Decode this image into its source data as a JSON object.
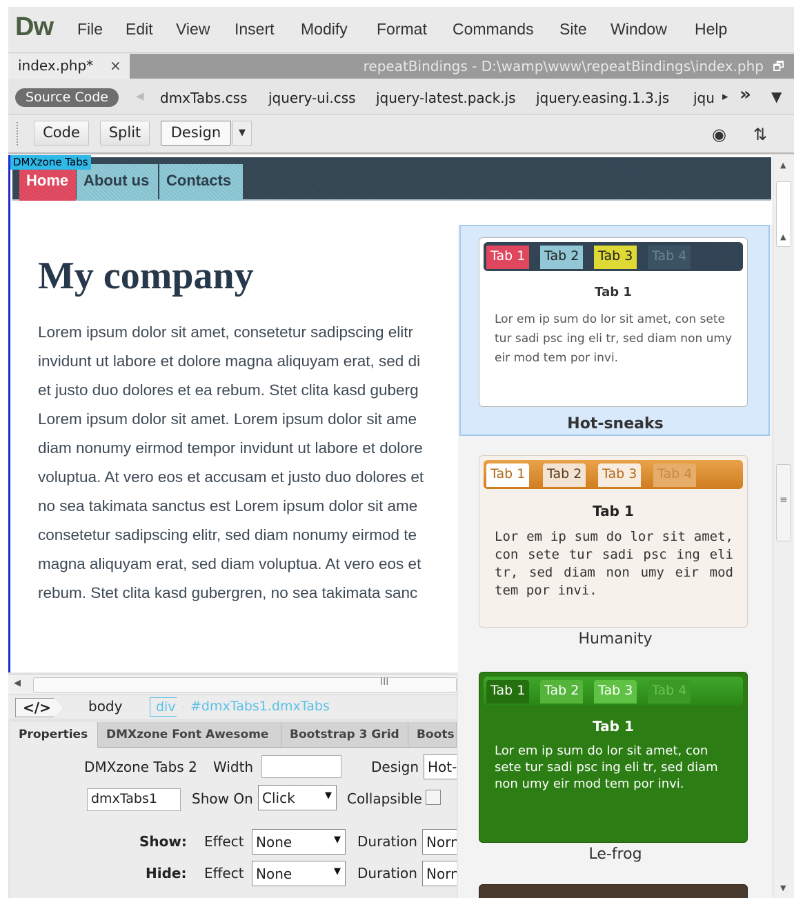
{
  "app": {
    "logo": "Dw"
  },
  "menu": [
    "File",
    "Edit",
    "View",
    "Insert",
    "Modify",
    "Format",
    "Commands",
    "Site",
    "Window",
    "Help"
  ],
  "doc_tab": {
    "name": "index.php*",
    "close": "×",
    "path": "repeatBindings - D:\\wamp\\www\\repeatBindings\\index.php",
    "restore": "🗗"
  },
  "related_files": {
    "source": "Source Code",
    "files": [
      "dmxTabs.css",
      "jquery-ui.css",
      "jquery-latest.pack.js",
      "jquery.easing.1.3.js",
      "jqu"
    ],
    "nav_next": "▸",
    "nav_more": "»",
    "filter": "▼"
  },
  "view_bar": {
    "code": "Code",
    "split": "Split",
    "design": "Design",
    "dropdown": "▼",
    "globe": "◉",
    "sort": "⇅"
  },
  "page": {
    "component_label": "DMXzone Tabs",
    "nav": [
      "Home",
      "About us",
      "Contacts"
    ],
    "heading": "My company",
    "lorem_lines": [
      "Lorem ipsum dolor sit amet, consetetur sadipscing elitr",
      "invidunt ut labore et dolore magna aliquyam erat, sed di",
      "et justo duo dolores et ea rebum. Stet clita kasd guberg",
      "Lorem ipsum dolor sit amet. Lorem ipsum dolor sit ame",
      "diam nonumy eirmod tempor invidunt ut labore et dolore",
      "voluptua. At vero eos et accusam et justo duo dolores et",
      "no sea takimata sanctus est Lorem ipsum dolor sit ame",
      "consetetur sadipscing elitr, sed diam nonumy eirmod te",
      "magna aliquyam erat, sed diam voluptua. At vero eos et",
      "rebum. Stet clita kasd gubergren, no sea takimata sanc"
    ]
  },
  "scroll": {
    "left": "◀",
    "grip": "III",
    "up": "▲",
    "down": "▼",
    "grip_v": "≡"
  },
  "tag_selector": {
    "code": "</>",
    "body": "body",
    "div": "div",
    "id": "#dmxTabs1.dmxTabs"
  },
  "prop_tabs": [
    "Properties",
    "DMXzone Font Awesome",
    "Bootstrap 3 Grid",
    "Boots"
  ],
  "props": {
    "component": "DMXzone Tabs 2",
    "width_label": "Width",
    "width_value": "",
    "design_label": "Design",
    "design_value": "Hot-",
    "id_value": "dmxTabs1",
    "show_on_label": "Show On",
    "show_on_value": "Click",
    "collapsible_label": "Collapsible",
    "show_label": "Show:",
    "hide_label": "Hide:",
    "effect_label": "Effect",
    "effect_show": "None",
    "effect_hide": "None",
    "duration_label": "Duration",
    "duration_show": "Norn",
    "duration_hide": "Norn",
    "dd": "▼"
  },
  "design_cards": [
    {
      "name": "Hot-sneaks",
      "tabs": [
        "Tab 1",
        "Tab 2",
        "Tab 3",
        "Tab 4"
      ],
      "heading": "Tab 1",
      "body": "Lor em ip sum do lor sit amet, con sete tur sadi psc ing eli tr, sed diam non umy eir mod tem por invi.",
      "colors": {
        "strip": "#35495a",
        "tab1": "#e0475f",
        "tab2": "#92c7d6",
        "tab3": "#dfd936",
        "tab4": "#3b5262"
      }
    },
    {
      "name": "Humanity",
      "tabs": [
        "Tab 1",
        "Tab 2",
        "Tab 3",
        "Tab 4"
      ],
      "heading": "Tab 1",
      "body": "Lor em ip sum do lor sit amet, con sete tur sadi psc ing eli tr, sed diam non umy eir mod tem por invi.",
      "colors": {
        "strip": "#d98a2c",
        "tab": "#f5eae0"
      }
    },
    {
      "name": "Le-frog",
      "tabs": [
        "Tab 1",
        "Tab 2",
        "Tab 3",
        "Tab 4"
      ],
      "heading": "Tab 1",
      "body": "Lor em ip sum do lor sit amet, con sete tur sadi psc ing eli tr, sed diam non umy eir mod tem por invi.",
      "colors": {
        "strip": "#2f8f1a",
        "body": "#2c7d14"
      }
    }
  ]
}
